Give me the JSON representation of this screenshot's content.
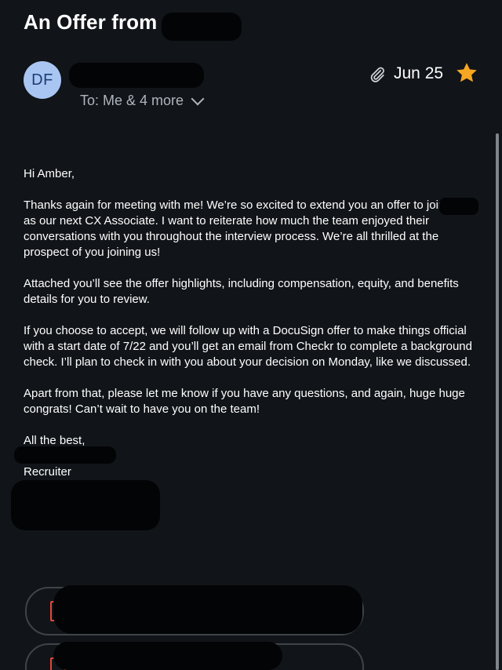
{
  "email": {
    "subject": "An Offer from",
    "sender_initials": "DF",
    "recipients": "To: Me & 4 more",
    "date": "Jun 25",
    "starred": true,
    "body": {
      "greeting": "Hi Amber,",
      "p1": "Thanks again for meeting with me! We’re so excited to extend you an offer to join",
      "p1b": "as our next CX Associate. I want to reiterate how much the team enjoyed their conversations with you throughout the interview process. We’re all thrilled at the prospect of you joining us!",
      "p2": "Attached you’ll see the offer highlights, including compensation, equity, and benefits details for you to review.",
      "p3": "If you choose to accept, we will follow up with a DocuSign offer to make things official with a start date of 7/22 and you’ll get an email from Checkr to complete a background check. I’ll plan to check in with you about your decision on Monday, like we discussed.",
      "p4": "Apart from that, please let me know if you have any questions, and again, huge huge congrats! Can’t wait to have you on the team!",
      "closing": "All the best,",
      "signature_title": "Recruiter"
    }
  },
  "colors": {
    "background": "#111418",
    "avatar": "#a9c6f3",
    "star": "#f5a623",
    "pdf": "#e0483b"
  },
  "icons": {
    "attachment": "paperclip-icon",
    "star": "star-icon",
    "expand": "chevron-down-icon",
    "file": "pdf-file-icon"
  }
}
